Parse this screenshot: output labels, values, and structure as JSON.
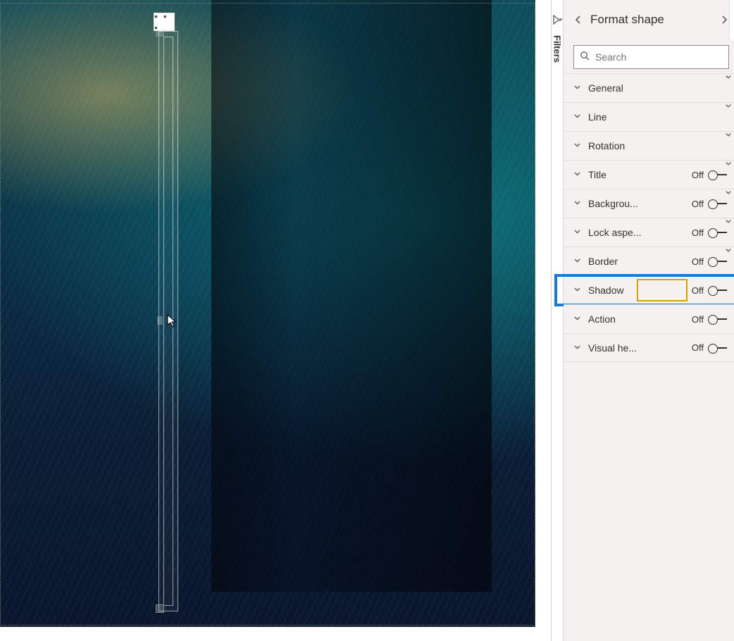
{
  "panel": {
    "title": "Format shape",
    "search_placeholder": "Search",
    "filters_label": "Filters"
  },
  "sections": [
    {
      "label": "General",
      "has_toggle": false
    },
    {
      "label": "Line",
      "has_toggle": false
    },
    {
      "label": "Rotation",
      "has_toggle": false
    },
    {
      "label": "Title",
      "has_toggle": true,
      "toggle_state": "Off"
    },
    {
      "label": "Backgrou...",
      "has_toggle": true,
      "toggle_state": "Off"
    },
    {
      "label": "Lock aspe...",
      "has_toggle": true,
      "toggle_state": "Off"
    },
    {
      "label": "Border",
      "has_toggle": true,
      "toggle_state": "Off"
    },
    {
      "label": "Shadow",
      "has_toggle": true,
      "toggle_state": "Off",
      "highlighted": true
    },
    {
      "label": "Action",
      "has_toggle": true,
      "toggle_state": "Off"
    },
    {
      "label": "Visual he...",
      "has_toggle": true,
      "toggle_state": "Off"
    }
  ],
  "canvas": {
    "more_options_glyph": "• • •"
  }
}
